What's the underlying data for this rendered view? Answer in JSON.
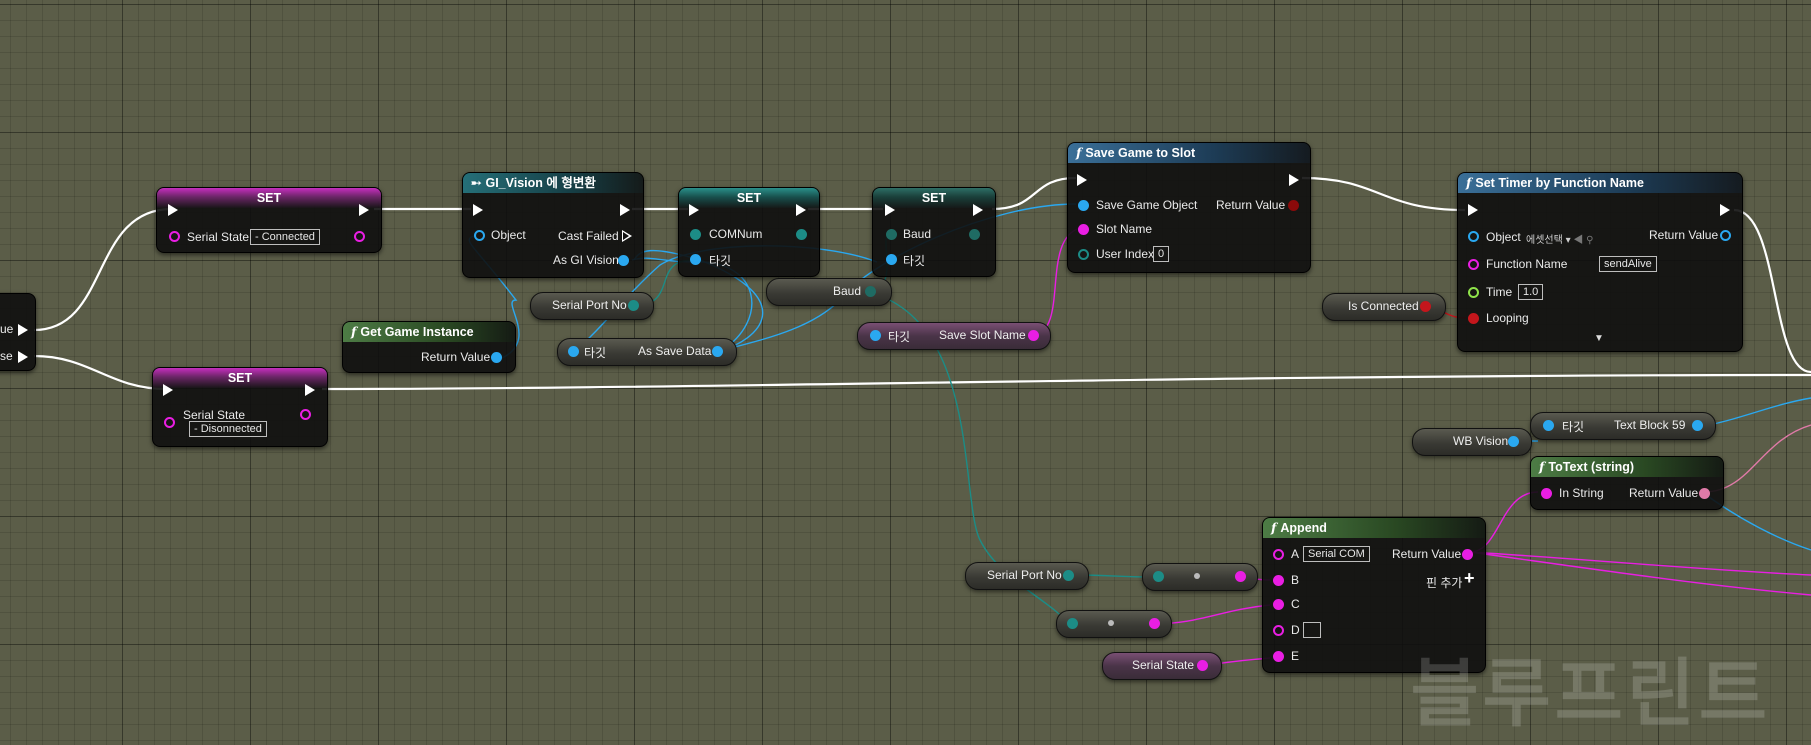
{
  "branch_node": {
    "true_label": "ue",
    "false_label": "se"
  },
  "set_connected": {
    "title": "SET",
    "var_label": "Serial State",
    "value": " - Connected"
  },
  "set_disconnected": {
    "title": "SET",
    "var_label": "Serial State",
    "value": " - Disonnected"
  },
  "get_game_instance": {
    "title": "Get Game Instance",
    "output": "Return Value"
  },
  "cast_node": {
    "title": "GI_Vision 에 형변환",
    "input_object": "Object",
    "cast_failed": "Cast Failed",
    "output": "As GI Vision"
  },
  "set_comnum": {
    "title": "SET",
    "var_label": "COMNum",
    "target_label": "타깃"
  },
  "set_baud": {
    "title": "SET",
    "var_label": "Baud",
    "target_label": "타깃"
  },
  "var_serial_port_no_1": {
    "label": "Serial Port No"
  },
  "var_as_save_data": {
    "target": "타깃",
    "label": "As Save Data"
  },
  "var_baud": {
    "label": "Baud"
  },
  "var_save_slot_name": {
    "target": "타깃",
    "label": "Save Slot Name"
  },
  "save_game_node": {
    "title": "Save Game to Slot",
    "pin_save_game_object": "Save Game Object",
    "pin_slot_name": "Slot Name",
    "pin_user_index": "User Index",
    "user_index_value": "0",
    "output": "Return Value"
  },
  "set_timer_node": {
    "title": "Set Timer by Function Name",
    "pin_object": "Object",
    "object_value": "에셋선택",
    "pin_function_name": "Function Name",
    "function_name_value": "sendAlive",
    "pin_time": "Time",
    "time_value": "1.0",
    "pin_looping": "Looping",
    "output": "Return Value"
  },
  "var_is_connected": {
    "label": "Is Connected"
  },
  "var_wb_vision": {
    "label": "WB Vision"
  },
  "var_text_block": {
    "target": "타깃",
    "label": "Text Block 59"
  },
  "totext_node": {
    "title": "ToText (string)",
    "input": "In String",
    "output": "Return Value"
  },
  "append_node": {
    "title": "Append",
    "pin_a": "A",
    "a_value": "Serial COM",
    "pin_b": "B",
    "pin_c": "C",
    "pin_d": "D",
    "pin_e": "E",
    "output": "Return Value",
    "add_pin": "핀 추가"
  },
  "var_serial_port_no_2": {
    "label": "Serial Port No"
  },
  "var_serial_state": {
    "label": "Serial State"
  },
  "watermark": "블루프린트",
  "colors": {
    "exec": "#ffffff",
    "string": "#e91ee3",
    "object": "#2aa8f0",
    "int": "#1c8c86",
    "bool": "#8b0a0a",
    "float": "#8fe34a",
    "text": "#e07aa8"
  }
}
